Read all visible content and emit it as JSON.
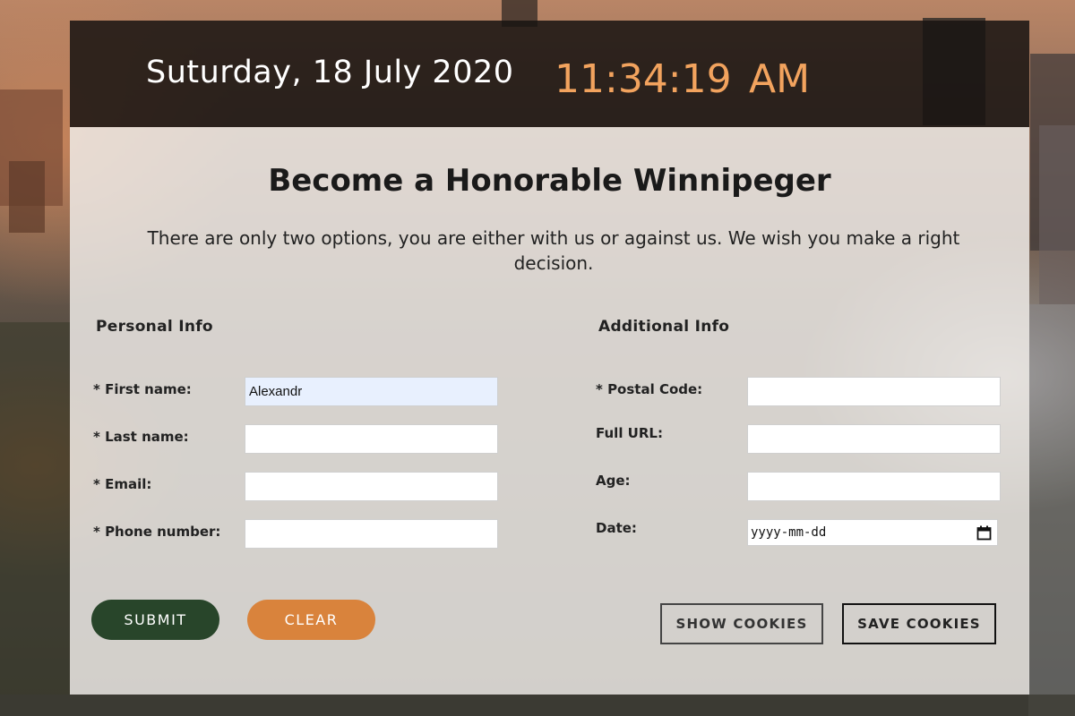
{
  "clock": {
    "date": "Suturday, 18 July 2020",
    "time": "11:34:19",
    "ampm": "AM"
  },
  "form": {
    "title": "Become a Honorable Winnipeger",
    "subtitle": "There are only two options, you are either with us or against us. We wish you make a right decision.",
    "personal": {
      "heading": "Personal Info",
      "first_name_label": "* First name:",
      "first_name_value": "Alexandr",
      "last_name_label": "* Last name:",
      "last_name_value": "",
      "email_label": "* Email:",
      "email_value": "",
      "phone_label": "* Phone number:",
      "phone_value": ""
    },
    "additional": {
      "heading": "Additional Info",
      "postal_label": "* Postal Code:",
      "postal_value": "",
      "url_label": "Full URL:",
      "url_value": "",
      "age_label": "Age:",
      "age_value": "",
      "date_label": "Date:",
      "date_placeholder": "yyyy-mm-dd"
    },
    "buttons": {
      "submit": "SUBMIT",
      "clear": "CLEAR",
      "show_cookies": "SHOW COOKIES",
      "save_cookies": "SAVE COOKIES"
    }
  },
  "icons": {
    "date_picker": "calendar-icon"
  },
  "colors": {
    "time_accent": "#f2a35e",
    "submit_bg": "#28452a",
    "clear_bg": "#d9833c"
  }
}
